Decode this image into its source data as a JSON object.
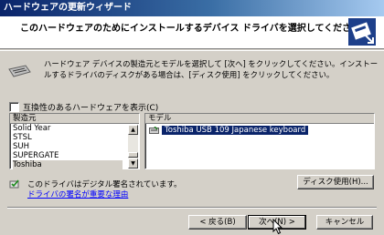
{
  "window": {
    "title": "ハードウェアの更新ウィザード"
  },
  "header": {
    "title": "このハードウェアのためにインストールするデバイス ドライバを選択してください。"
  },
  "description": "ハードウェア デバイスの製造元とモデルを選択して [次へ] をクリックしてください。インストールするドライバのディスクがある場合は、[ディスク使用] をクリックしてください。",
  "compat_checkbox": {
    "label": "互換性のあるハードウェアを表示(C)",
    "checked": false
  },
  "manufacturer": {
    "header": "製造元",
    "items": [
      "Solid Year",
      "STSL",
      "SUH",
      "SUPERGATE",
      "Toshiba"
    ],
    "selected": "Toshiba"
  },
  "model": {
    "header": "モデル",
    "items": [
      "Toshiba USB 109 Japanese keyboard"
    ],
    "selected": "Toshiba USB 109 Japanese keyboard"
  },
  "signature": {
    "text": "このドライバはデジタル署名されています。",
    "link": "ドライバの署名が重要な理由"
  },
  "buttons": {
    "disk": "ディスク使用(H)...",
    "back": "< 戻る(B)",
    "next": "次へ(N) >",
    "cancel": "キャンセル"
  },
  "icons": {
    "header": "hardware-wizard-icon",
    "description": "keyboard-icon",
    "model_item": "keyboard-icon",
    "signature": "signed-driver-icon"
  }
}
